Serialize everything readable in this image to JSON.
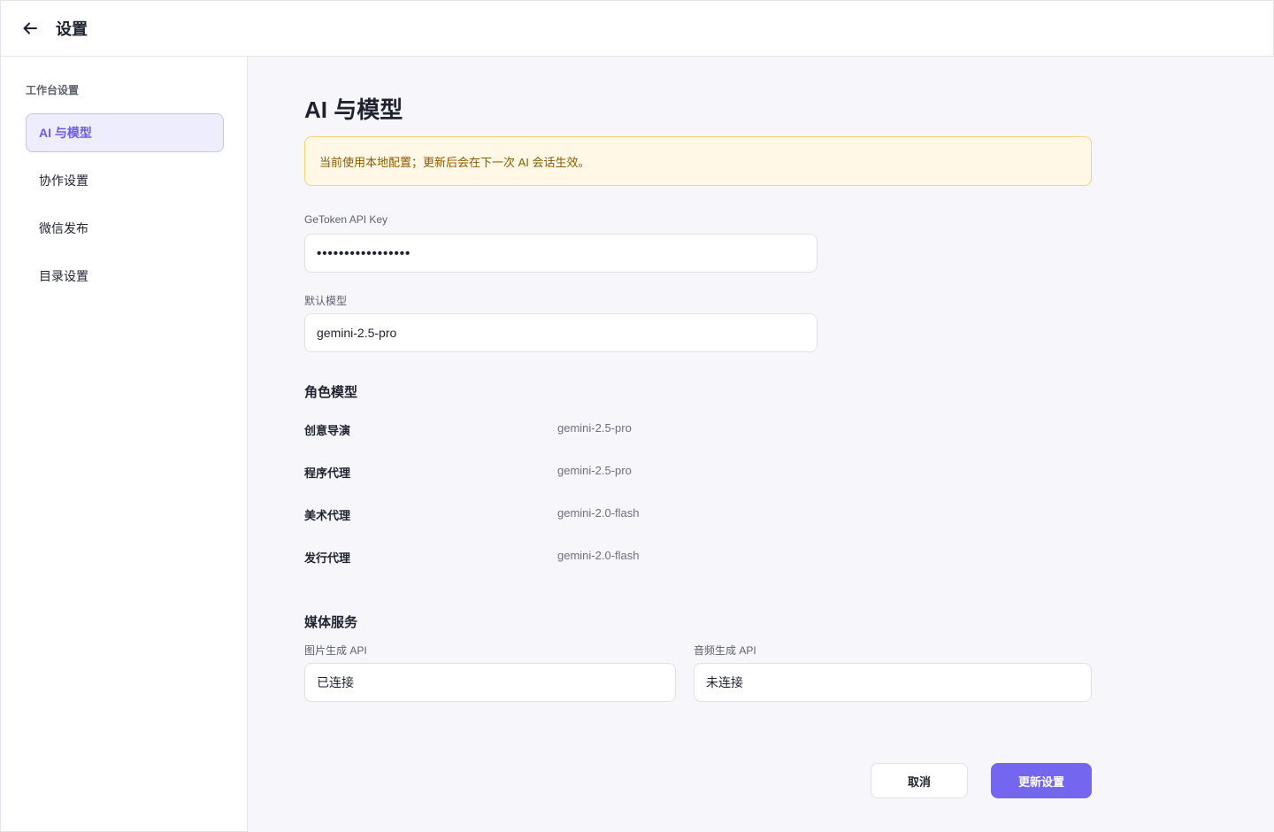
{
  "header": {
    "back_icon": "arrow-left-icon",
    "title": "设置"
  },
  "sidebar": {
    "heading": "工作台设置",
    "items": [
      {
        "label": "AI 与模型",
        "active": true
      },
      {
        "label": "协作设置",
        "active": false
      },
      {
        "label": "微信发布",
        "active": false
      },
      {
        "label": "目录设置",
        "active": false
      }
    ]
  },
  "main": {
    "title": "AI 与模型",
    "notice": "当前使用本地配置；更新后会在下一次 AI 会话生效。",
    "api_key": {
      "label": "GeToken API Key",
      "value": "•••••••••••••••••"
    },
    "default_model": {
      "label": "默认模型",
      "value": "gemini-2.5-pro"
    },
    "roles_section": {
      "title": "角色模型",
      "roles": [
        {
          "name": "创意导演",
          "model": "gemini-2.5-pro"
        },
        {
          "name": "程序代理",
          "model": "gemini-2.5-pro"
        },
        {
          "name": "美术代理",
          "model": "gemini-2.0-flash"
        },
        {
          "name": "发行代理",
          "model": "gemini-2.0-flash"
        }
      ]
    },
    "media_section": {
      "title": "媒体服务",
      "image_api": {
        "label": "图片生成 API",
        "value": "已连接"
      },
      "audio_api": {
        "label": "音频生成 API",
        "value": "未连接"
      }
    },
    "actions": {
      "cancel_label": "取消",
      "save_label": "更新设置"
    }
  },
  "colors": {
    "accent": "#7466ee",
    "active_bg": "#eeedfd",
    "notice_bg": "#fff8e6",
    "notice_border": "#f3d37a",
    "notice_text": "#8a5a00"
  }
}
